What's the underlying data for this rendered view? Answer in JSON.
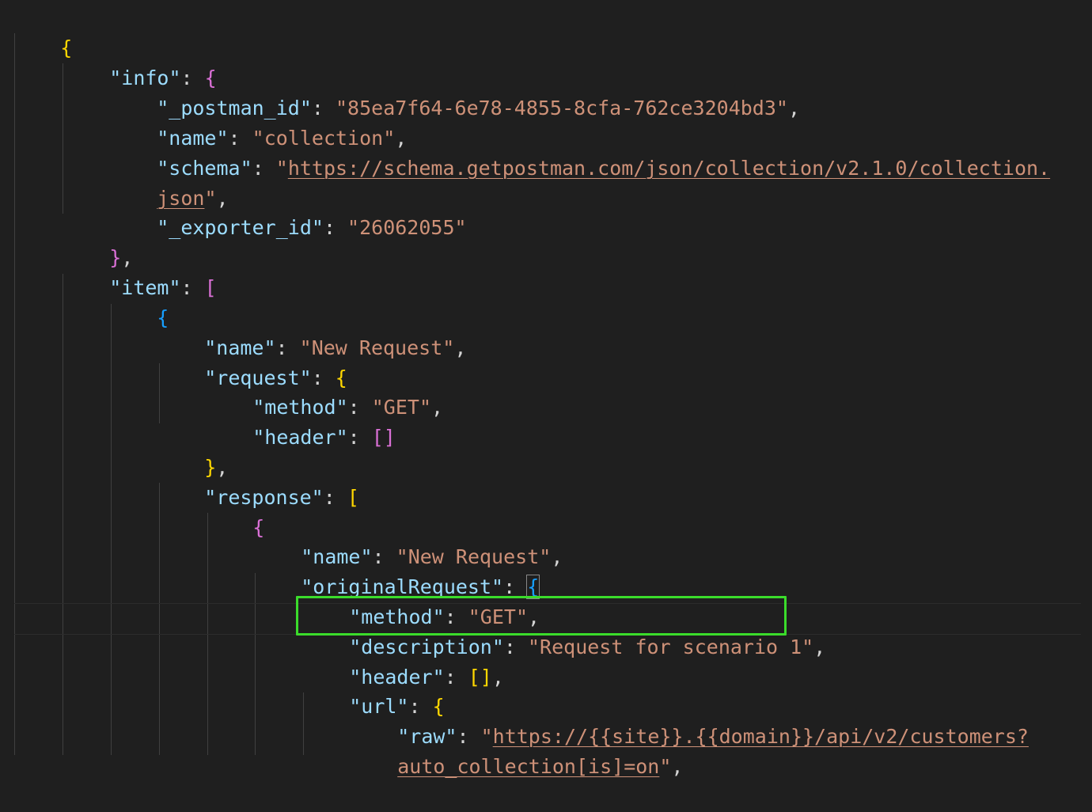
{
  "json": {
    "open_brace": "{",
    "info_key": "\"info\"",
    "postman_id_key": "\"_postman_id\"",
    "postman_id_value": "\"85ea7f64-6e78-4855-8cfa-762ce3204bd3\"",
    "info_name_key": "\"name\"",
    "info_name_value": "\"collection\"",
    "schema_key": "\"schema\"",
    "schema_value_part1": "https://schema.getpostman.com/json/collection/v2.1.0/collection.",
    "schema_value_part2": "json",
    "exporter_id_key": "\"_exporter_id\"",
    "exporter_id_value": "\"26062055\"",
    "item_key": "\"item\"",
    "item_name_key": "\"name\"",
    "item_name_value": "\"New Request\"",
    "request_key": "\"request\"",
    "method_key": "\"method\"",
    "method_value": "\"GET\"",
    "header_key": "\"header\"",
    "response_key": "\"response\"",
    "response_name_key": "\"name\"",
    "response_name_value": "\"New Request\"",
    "original_request_key": "\"originalRequest\"",
    "orig_method_key": "\"method\"",
    "orig_method_value": "\"GET\"",
    "description_key": "\"description\"",
    "description_value": "\"Request for scenario 1\"",
    "orig_header_key": "\"header\"",
    "url_key": "\"url\"",
    "raw_key": "\"raw\"",
    "raw_value_part1": "https://{{site}}.{{domain}}/api/v2/customers?",
    "raw_value_part2": "auto_collection[is]=on"
  },
  "colors": {
    "background": "#1f1f1f",
    "key": "#9cdcfe",
    "string": "#ce9178",
    "punctuation": "#d4d4d4",
    "bracket_level1": "#ffd700",
    "bracket_level2": "#da70d6",
    "bracket_level3": "#179fff",
    "highlight_box": "#3bdc2b"
  }
}
